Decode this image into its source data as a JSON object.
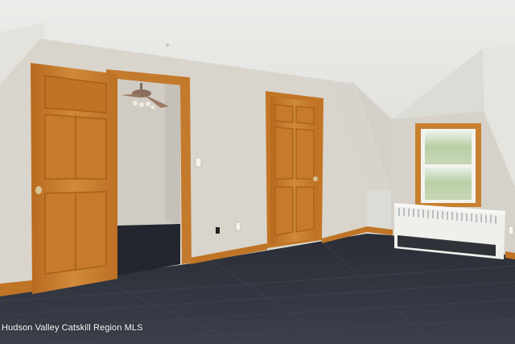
{
  "watermark": {
    "text": "Hudson Valley Catskill Region MLS"
  },
  "colors": {
    "ceiling": "#e9e9e5",
    "wall": "#d8d4cc",
    "door_wood": "#c67a2a",
    "floor": "#2c2f38",
    "radiator": "#eeeeec",
    "window_view": "#cfe0c0"
  }
}
